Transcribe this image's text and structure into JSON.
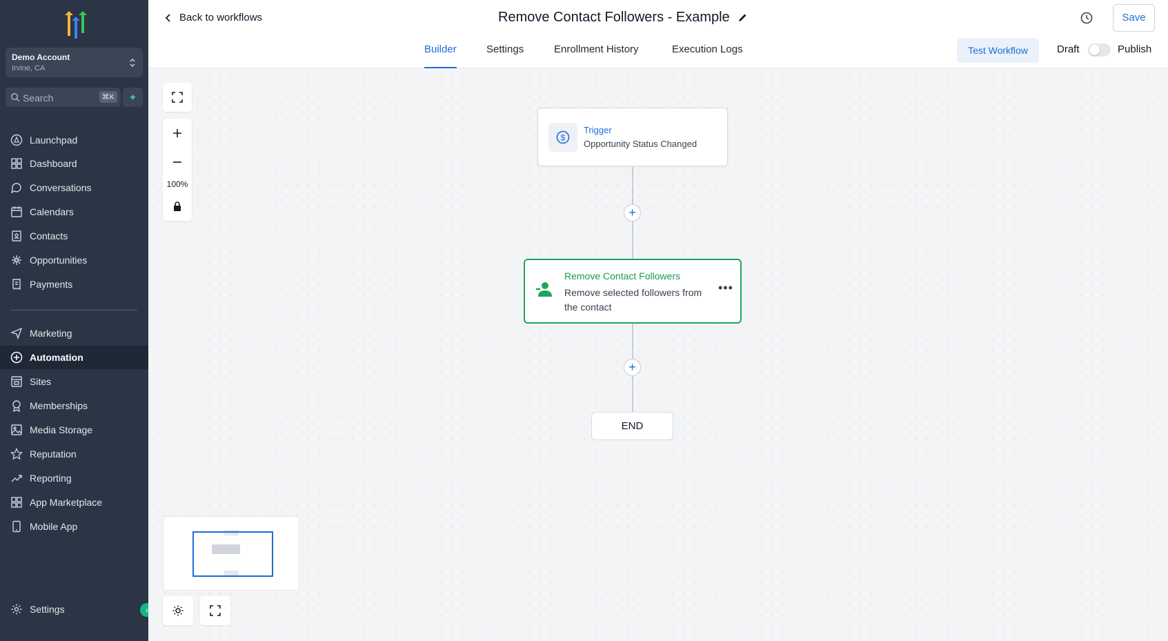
{
  "sidebar": {
    "account": {
      "name": "Demo Account",
      "location": "Irvine, CA"
    },
    "search": {
      "placeholder": "Search",
      "shortcut": "⌘K"
    },
    "items": [
      {
        "label": "Launchpad",
        "icon": "rocket-icon"
      },
      {
        "label": "Dashboard",
        "icon": "grid-icon"
      },
      {
        "label": "Conversations",
        "icon": "chat-bubble-icon"
      },
      {
        "label": "Calendars",
        "icon": "calendar-icon"
      },
      {
        "label": "Contacts",
        "icon": "contact-book-icon"
      },
      {
        "label": "Opportunities",
        "icon": "network-icon"
      },
      {
        "label": "Payments",
        "icon": "receipt-icon"
      },
      {
        "label": "Marketing",
        "icon": "send-icon"
      },
      {
        "label": "Automation",
        "icon": "automation-icon",
        "active": true
      },
      {
        "label": "Sites",
        "icon": "web-page-icon"
      },
      {
        "label": "Memberships",
        "icon": "badge-icon"
      },
      {
        "label": "Media Storage",
        "icon": "image-icon"
      },
      {
        "label": "Reputation",
        "icon": "star-icon"
      },
      {
        "label": "Reporting",
        "icon": "trend-icon"
      },
      {
        "label": "App Marketplace",
        "icon": "apps-icon"
      },
      {
        "label": "Mobile App",
        "icon": "phone-icon"
      }
    ],
    "settings_label": "Settings"
  },
  "header": {
    "back_label": "Back to workflows",
    "title": "Remove Contact Followers - Example",
    "save_label": "Save",
    "tabs": [
      "Builder",
      "Settings",
      "Enrollment History",
      "Execution Logs"
    ],
    "active_tab": "Builder",
    "test_label": "Test Workflow",
    "draft_label": "Draft",
    "publish_label": "Publish",
    "published": false
  },
  "canvas": {
    "zoom": "100%",
    "trigger": {
      "label": "Trigger",
      "subtitle": "Opportunity Status Changed"
    },
    "action": {
      "title": "Remove Contact Followers",
      "description": "Remove selected followers from the contact"
    },
    "end_label": "END"
  },
  "colors": {
    "accent": "#1d6cd9",
    "success": "#22a45d",
    "sidebar": "#2b3545"
  }
}
